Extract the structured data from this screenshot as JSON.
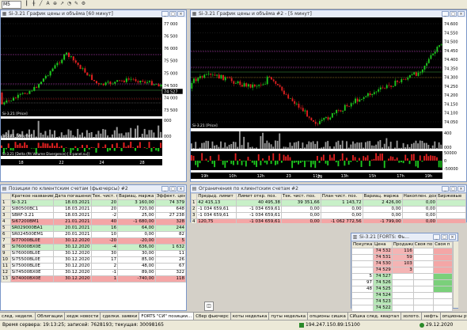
{
  "toolbar": {
    "interval": "M5",
    "icons": [
      "bars-icon",
      "candles-icon",
      "line-icon",
      "text-icon",
      "zoom-icon",
      "arrow-icon",
      "bell-icon",
      "draw-icon",
      "tools-icon"
    ]
  },
  "chart1": {
    "title": "Si-3.21 График цены и объёма [60 минут]",
    "price_ticks": [
      "77 000",
      "76 500",
      "76 000",
      "75 500",
      "75 000",
      "74 500",
      "74 000",
      "73 500"
    ],
    "price_caption": "Si-3.21 [Price]",
    "volume_caption": "Si-3.21 [Volume]",
    "volume_ticks": [
      "000",
      "000"
    ],
    "pvd_caption": "Si-3.21 [Delta (Pit Volume Divergence) [ k-panel.su]]",
    "dates": [
      "18",
      "22",
      "24",
      "28"
    ],
    "price_tag": "74 527"
  },
  "chart2": {
    "title": "Si-3.21 График цены и объёма #2 - [5 минут]",
    "price_ticks": [
      "74.600",
      "74.550",
      "74.500",
      "74.450",
      "74.400",
      "74.350",
      "74.300",
      "74.250",
      "74.200",
      "74.150",
      "74.100",
      "74.050"
    ],
    "price_caption": "Si-3.21 [Price]",
    "volume_ticks": [
      "400",
      "000"
    ],
    "pvd_ticks": [
      "50000",
      "0",
      "-50000"
    ],
    "hours": [
      "19h",
      "10h",
      "12h",
      "23",
      "11h",
      "13h",
      "15h",
      "17h",
      "19h"
    ],
    "date_label": "29"
  },
  "positions": {
    "title": "Позиции по клиентским счетам (фьючерсы) #2",
    "columns": [
      "Краткое название",
      "Дата погашения",
      "Тек. чист. поз.",
      "Вариац. маржа",
      "Эффект. цена"
    ],
    "rows": [
      {
        "n": "1",
        "name": "Si-3.21",
        "date": "18.03.2021",
        "pos": "20",
        "var": "3 160,00",
        "price": "74 379",
        "color": "#c8f0c8"
      },
      {
        "n": "2",
        "name": "SI80500BC1",
        "date": "18.03.2021",
        "pos": "20",
        "var": "720,00",
        "price": "648",
        "color": "#ffffff"
      },
      {
        "n": "3",
        "name": "SBRF-3.21",
        "date": "18.03.2021",
        "pos": "-2",
        "var": "25,00",
        "price": "27 238",
        "color": "#ffffff"
      },
      {
        "n": "4",
        "name": "Si67200BM1",
        "date": "21.01.2021",
        "pos": "40",
        "var": "-1 680,00",
        "price": "328",
        "color": "#f4a6a6"
      },
      {
        "n": "5",
        "name": "SR029000BA1",
        "date": "20.01.2021",
        "pos": "16",
        "var": "64,00",
        "price": "244",
        "color": "#c8f0c8"
      },
      {
        "n": "6",
        "name": "SR024500EM1",
        "date": "20.01.2021",
        "pos": "10",
        "var": "0,00",
        "price": "82",
        "color": "#ffffff"
      },
      {
        "n": "7",
        "name": "Si77000BL0E",
        "date": "30.12.2020",
        "pos": "-20",
        "var": "-20,00",
        "price": "5",
        "color": "#f4a6a6"
      },
      {
        "n": "8",
        "name": "Si76000BX0E",
        "date": "30.12.2020",
        "pos": "-4",
        "var": "636,00",
        "price": "1 632",
        "color": "#c8f0c8"
      },
      {
        "n": "9",
        "name": "Si76000BL0E",
        "date": "30.12.2020",
        "pos": "30",
        "var": "30,00",
        "price": "11",
        "color": "#ffffff"
      },
      {
        "n": "10",
        "name": "Si75500BL0E",
        "date": "30.12.2020",
        "pos": "17",
        "var": "85,00",
        "price": "26",
        "color": "#ffffff"
      },
      {
        "n": "11",
        "name": "Si75000BL0E",
        "date": "30.12.2020",
        "pos": "2",
        "var": "48,00",
        "price": "67",
        "color": "#ffffff"
      },
      {
        "n": "12",
        "name": "Si74500BX0E",
        "date": "30.12.2020",
        "pos": "-1",
        "var": "89,00",
        "price": "322",
        "color": "#ffffff"
      },
      {
        "n": "13",
        "name": "Si74000BX0E",
        "date": "30.12.2020",
        "pos": "1",
        "var": "-740,00",
        "price": "118",
        "color": "#f4a6a6"
      }
    ]
  },
  "limits": {
    "title": "Ограничения по клиентским счетам #2",
    "columns": [
      "Предыд. лимит",
      "Лимит откр. поз.",
      "Тек. чист. поз.",
      "План чист. поз.",
      "Вариац. маржа",
      "Накоплен. доход",
      "Биржевые"
    ],
    "rows": [
      {
        "n": "1",
        "c1": "42 415,13",
        "c2": "40 495,38",
        "c3": "39 351,66",
        "c4": "1 143,72",
        "c5": "2 426,00",
        "c6": "0,00",
        "color": "#c8f0c8"
      },
      {
        "n": "2",
        "c1": "-1 034 659,61",
        "c2": "-1 034 659,61",
        "c3": "0,00",
        "c4": "0,00",
        "c5": "0,00",
        "c6": "0,00",
        "color": "#ffffff"
      },
      {
        "n": "3",
        "c1": "-1 034 659,61",
        "c2": "-1 034 659,61",
        "c3": "0,00",
        "c4": "0,00",
        "c5": "0,00",
        "c6": "0,00",
        "color": "#ffffff"
      },
      {
        "n": "4",
        "c1": "120,75",
        "c2": "-1 034 659,61",
        "c3": "0,00",
        "c4": "-1 062 772,56",
        "c5": "-1 799,00",
        "c6": "0,00",
        "color": "#f4a6a6"
      }
    ]
  },
  "orderbook": {
    "title": "Si-3.21 [FORTS: Фь...",
    "columns": [
      "Покупка",
      "Цена",
      "Продажа",
      "Своя по",
      "Своя п"
    ],
    "rows": [
      {
        "buy": "",
        "price": "74 532",
        "sell": "116"
      },
      {
        "buy": "",
        "price": "74 531",
        "sell": "59"
      },
      {
        "buy": "",
        "price": "74 530",
        "sell": "103"
      },
      {
        "buy": "",
        "price": "74 529",
        "sell": "3"
      },
      {
        "buy": "5",
        "price": "74 527",
        "sell": ""
      },
      {
        "buy": "97",
        "price": "74 526",
        "sell": ""
      },
      {
        "buy": "48",
        "price": "74 525",
        "sell": ""
      },
      {
        "buy": "",
        "price": "74 524",
        "sell": ""
      },
      {
        "buy": "",
        "price": "74 523",
        "sell": ""
      },
      {
        "buy": "",
        "price": "74 522",
        "sell": ""
      }
    ]
  },
  "tabs": [
    "след. неделя.",
    "Облигации",
    "хедж новости",
    "сделки. заявки",
    "FORTS \"СИ\" позиции...",
    "Сбер фьючерс",
    "коты неделька",
    "путы неделька",
    "опционы сишка",
    "СИшка след. квартал",
    "золото.",
    "нефть",
    "опционы ртс"
  ],
  "status": {
    "server_time": "Время сервера: 19:13:25; записей: 7628193; текущая: 30098165",
    "ip": "194.247.150.89:15100",
    "date": "29.12.2020"
  }
}
